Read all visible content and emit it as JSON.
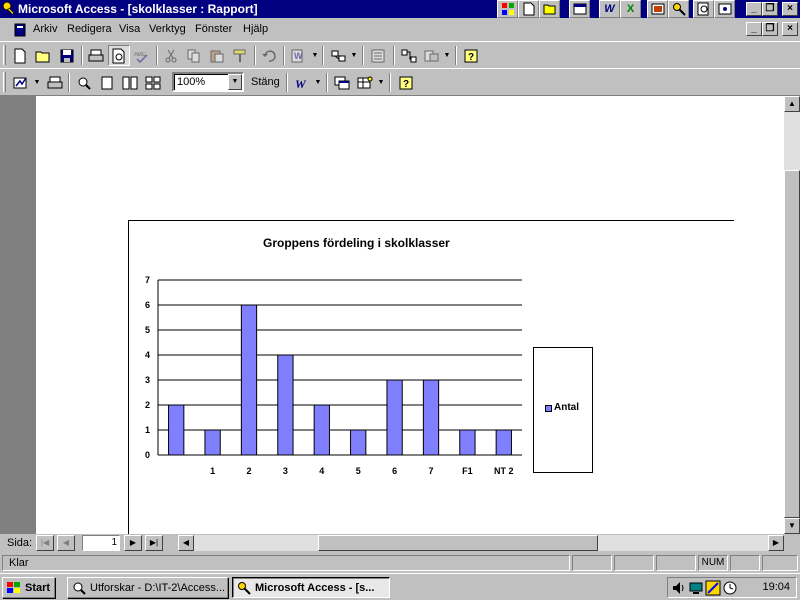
{
  "window": {
    "title": "Microsoft Access - [skolklasser : Rapport]"
  },
  "menu": {
    "items": [
      {
        "label": "Arkiv"
      },
      {
        "label": "Redigera"
      },
      {
        "label": "Visa"
      },
      {
        "label": "Verktyg"
      },
      {
        "label": "Fönster"
      },
      {
        "label": "Hjälp"
      }
    ]
  },
  "toolbar2": {
    "zoom_value": "100%",
    "close_label": "Stäng"
  },
  "report": {
    "chart_title": "Groppens fördeling i skolklasser",
    "legend_label": "Antal"
  },
  "chart_data": {
    "type": "bar",
    "title": "Groppens fördeling i skolklasser",
    "categories": [
      "",
      "1",
      "2",
      "3",
      "4",
      "5",
      "6",
      "7",
      "F1",
      "NT 2"
    ],
    "series": [
      {
        "name": "Antal",
        "values": [
          2,
          1,
          6,
          4,
          2,
          1,
          3,
          3,
          1,
          1
        ],
        "color": "#8080ff"
      }
    ],
    "y_ticks": [
      "0",
      "1",
      "2",
      "3",
      "4",
      "5",
      "6",
      "7"
    ],
    "ylim": [
      0,
      7
    ],
    "grid": true,
    "legend_position": "right"
  },
  "navigation": {
    "page_label": "Sida:",
    "page_number": "1"
  },
  "status": {
    "text": "Klar",
    "num_indicator": "NUM"
  },
  "taskbar": {
    "start_label": "Start",
    "tasks": [
      {
        "label": "Utforskar - D:\\IT-2\\Access..."
      },
      {
        "label": "Microsoft Access - [s..."
      }
    ],
    "clock": "19:04"
  }
}
